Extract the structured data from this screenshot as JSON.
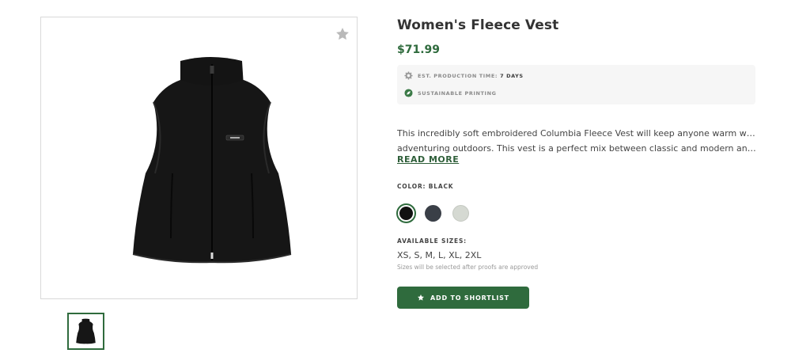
{
  "product": {
    "title": "Women's Fleece Vest",
    "price": "$71.99",
    "image_alt": "Black fleece vest"
  },
  "info": {
    "production_label": "EST. PRODUCTION TIME:",
    "production_value": "7 DAYS",
    "sustainable_label": "SUSTAINABLE PRINTING"
  },
  "description": {
    "line1": "This incredibly soft embroidered Columbia Fleece Vest will keep anyone warm while",
    "line2": "adventuring outdoors. This vest is a perfect mix between classic and modern and h...",
    "read_more": "READ MORE"
  },
  "color": {
    "label": "COLOR: BLACK",
    "options": [
      "#111111",
      "#3a3f47",
      "#d5d9d2"
    ],
    "selected_index": 0
  },
  "sizes": {
    "label": "AVAILABLE SIZES:",
    "value": "XS, S, M, L, XL, 2XL",
    "note": "Sizes will be selected after proofs are approved"
  },
  "cta": {
    "label": "ADD TO SHORTLIST"
  },
  "icons": {
    "favorite": "star-icon",
    "production": "gear-icon",
    "sustainable": "leaf-icon",
    "cta": "star-icon"
  },
  "colors": {
    "accent": "#2f6b3d",
    "info_bg": "#f6f6f6"
  }
}
